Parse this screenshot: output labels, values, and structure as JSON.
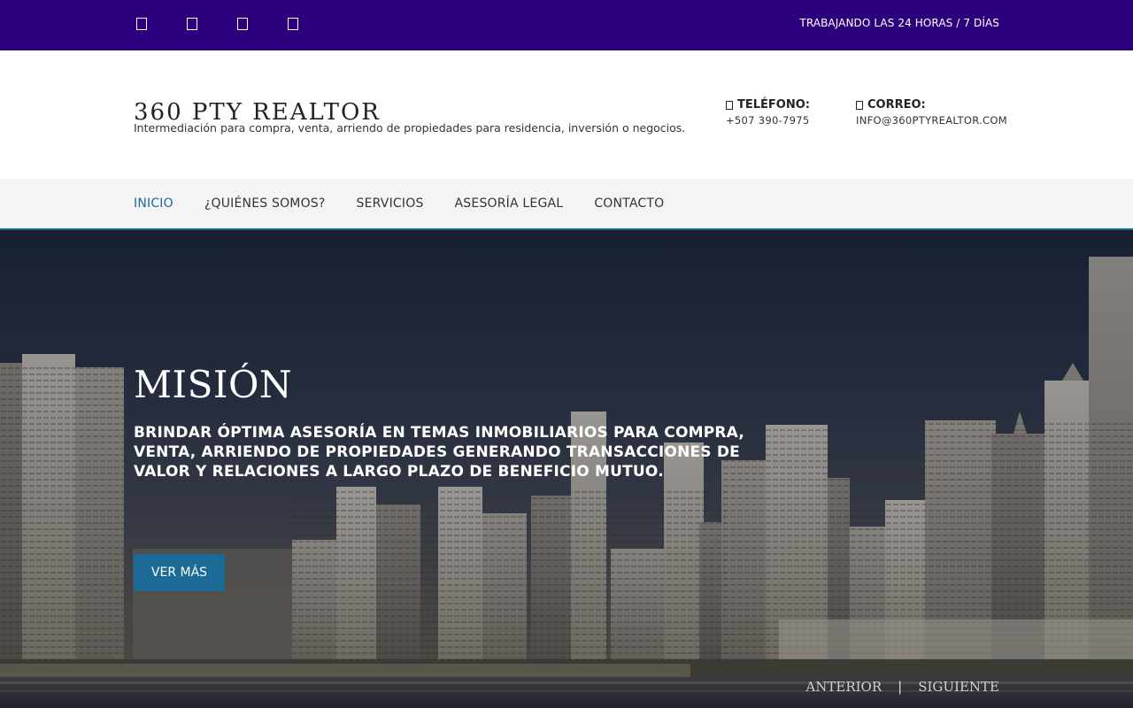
{
  "topbar": {
    "social_icons": [
      "facebook-icon",
      "twitter-icon",
      "instagram-icon",
      "linkedin-icon"
    ],
    "hours": "TRABAJANDO LAS 24 HORAS / 7 DÍAS",
    "background": "#2c007d"
  },
  "header": {
    "brand_name": "360 PTY REALTOR",
    "tagline": "Intermediación para compra, venta, arriendo de propiedades para residencia, inversión o negocios.",
    "phone_label": "TELÉFONO:",
    "phone_value": "+507 390-7975",
    "email_label": "CORREO:",
    "email_value": "INFO@360PTYREALTOR.COM"
  },
  "nav": {
    "items": [
      {
        "label": "INICIO",
        "active": true
      },
      {
        "label": "¿QUIÉNES SOMOS?",
        "active": false
      },
      {
        "label": "SERVICIOS",
        "active": false
      },
      {
        "label": "ASESORÍA LEGAL",
        "active": false
      },
      {
        "label": "CONTACTO",
        "active": false
      }
    ],
    "active_color": "#1a6c9c"
  },
  "hero": {
    "title": "MISIÓN",
    "text": "BRINDAR ÓPTIMA ASESORÍA EN TEMAS INMOBILIARIOS PARA COMPRA, VENTA, ARRIENDO DE PROPIEDADES GENERANDO TRANSACCIONES DE VALOR Y RELACIONES A LARGO PLAZO DE BENEFICIO MUTUO.",
    "cta_label": "VER MÁS",
    "prev_label": "ANTERIOR",
    "separator": "|",
    "next_label": "SIGUIENTE",
    "accent": "#1c6a96"
  }
}
